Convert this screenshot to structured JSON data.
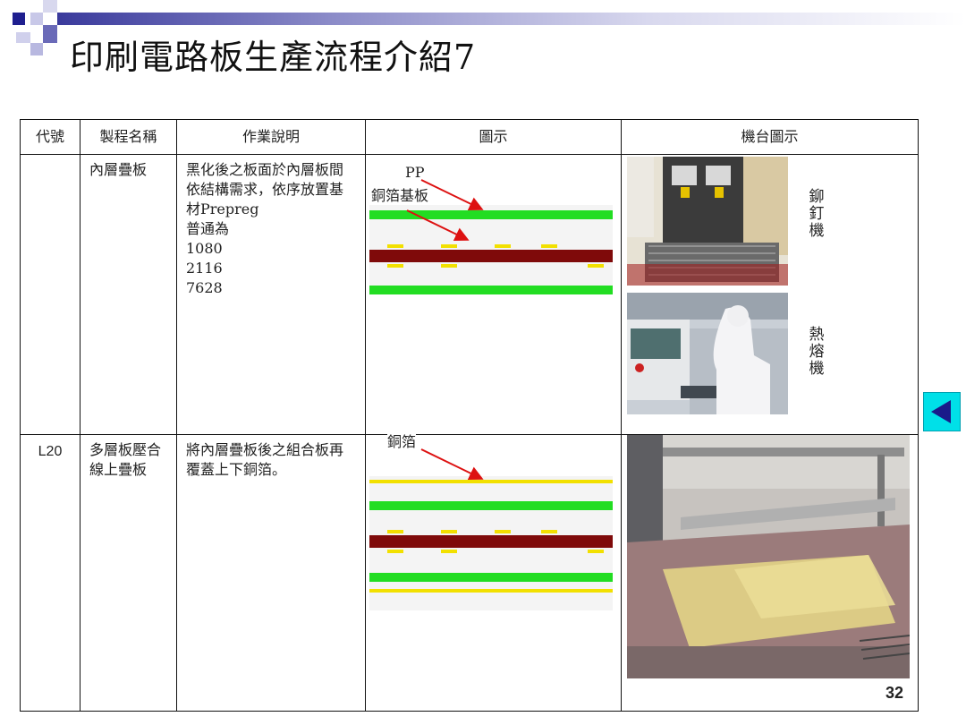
{
  "title": "印刷電路板生產流程介紹7",
  "table": {
    "headers": [
      "代號",
      "製程名稱",
      "作業說明",
      "圖示",
      "機台圖示"
    ],
    "rows": [
      {
        "code": "",
        "process": "內層疊板",
        "description": "黑化後之板面於內層板間依結構需求，依序放置基材Prepreg\n普通為\n1080\n2116\n7628",
        "diagram_labels": [
          "PP",
          "銅箔基板"
        ],
        "machines": [
          {
            "label": "鉚釘機",
            "photo": "riveting-machine-photo"
          },
          {
            "label": "熱熔機",
            "photo": "hot-melt-machine-photo"
          }
        ]
      },
      {
        "code": "L20",
        "process": "多層板壓合\n線上疊板",
        "description": "將內層疊板後之組合板再覆蓋上下銅箔。",
        "diagram_labels": [
          "銅箔"
        ],
        "machines": [
          {
            "label": "",
            "photo": "lamination-line-photo"
          }
        ]
      }
    ]
  },
  "page_number": "32",
  "colors": {
    "prepreg": "#22dd22",
    "core": "#7f0a0a",
    "copper_foil": "#f2e000",
    "arrow": "#dd1111",
    "nav_button": "#00e0e8"
  },
  "icons": {
    "nav": "back-arrow-icon"
  }
}
